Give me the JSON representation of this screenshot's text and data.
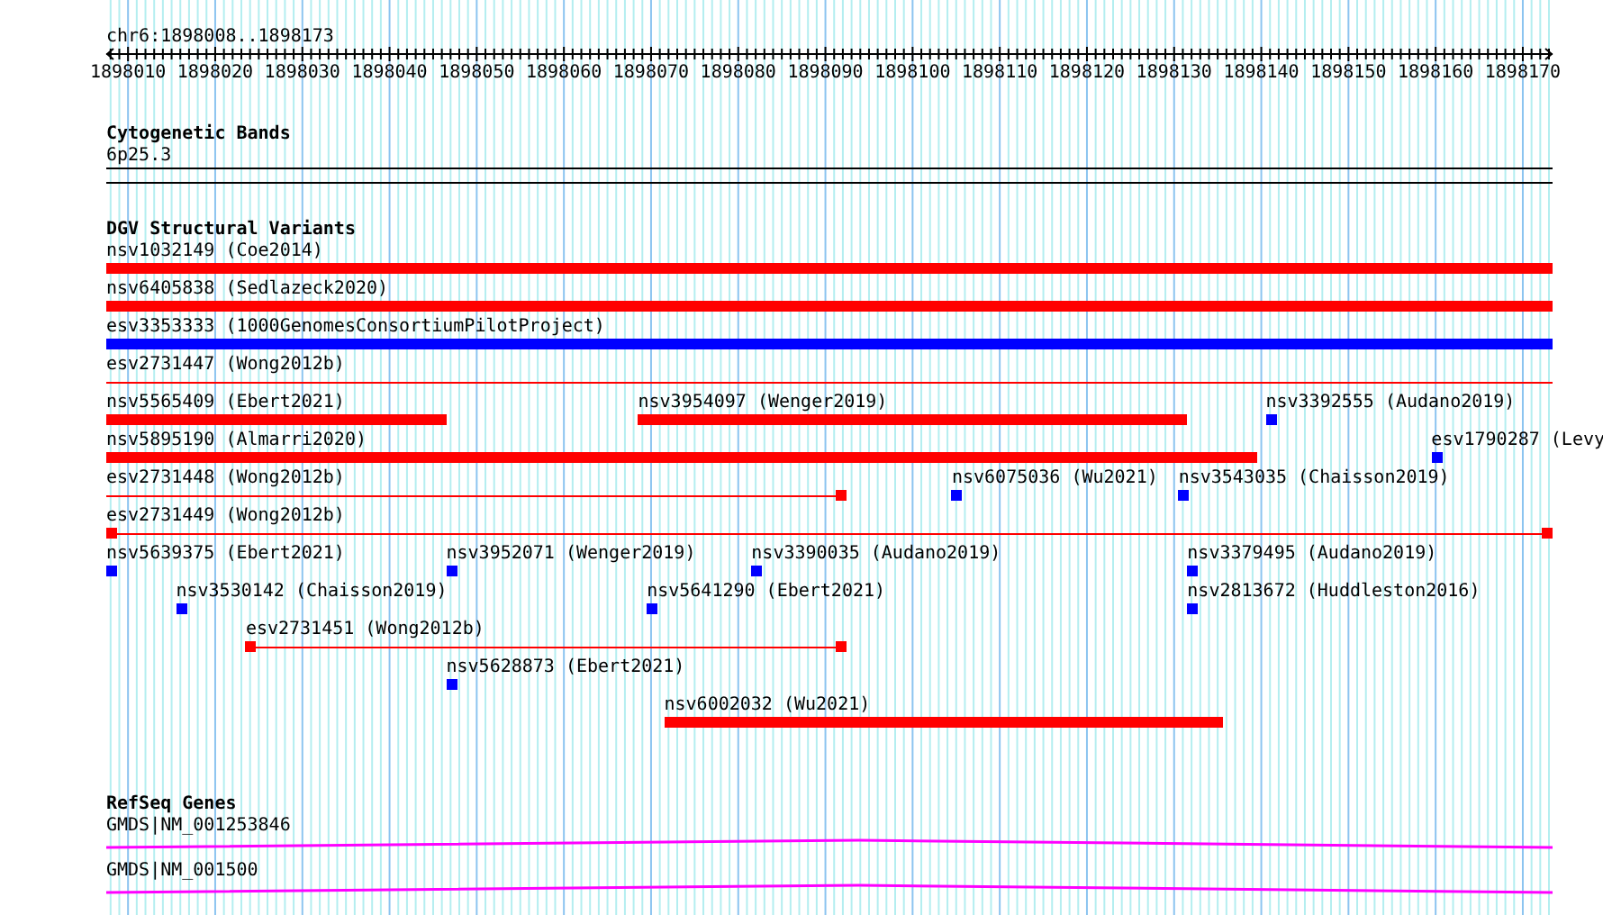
{
  "ruler": {
    "region": "chr6:1898008..1898173",
    "ticks": [
      "1898010",
      "1898020",
      "1898030",
      "1898040",
      "1898050",
      "1898060",
      "1898070",
      "1898080",
      "1898090",
      "1898100",
      "1898110",
      "1898120",
      "1898130",
      "1898140",
      "1898150",
      "1898160",
      "1898170"
    ]
  },
  "tracks": [
    {
      "kind": "band",
      "title": "Cytogenetic Bands",
      "label": "6p25.3"
    },
    {
      "kind": "variants",
      "title": "DGV Structural Variants",
      "lanes": [
        {
          "features": [
            {
              "label": "nsv1032149 (Coe2014)",
              "kind": "bar",
              "color": "#ff0000"
            }
          ]
        },
        {
          "features": [
            {
              "label": "nsv6405838 (Sedlazeck2020)",
              "kind": "bar",
              "color": "#ff0000"
            }
          ]
        },
        {
          "features": [
            {
              "label": "esv3353333 (1000GenomesConsortiumPilotProject)",
              "kind": "bar",
              "color": "#0000ff"
            }
          ]
        },
        {
          "features": [
            {
              "label": "esv2731447 (Wong2012b)",
              "kind": "thin",
              "color": "#ff0000"
            }
          ]
        },
        {
          "features": [
            {
              "label": "nsv5565409 (Ebert2021)",
              "kind": "bar",
              "color": "#ff0000"
            },
            {
              "label": "nsv3954097 (Wenger2019)",
              "kind": "bar",
              "color": "#ff0000"
            },
            {
              "label": "nsv3392555 (Audano2019)",
              "kind": "point",
              "color": "#0000ff"
            }
          ]
        },
        {
          "features": [
            {
              "label": "nsv5895190 (Almarri2020)",
              "kind": "bar",
              "color": "#ff0000"
            },
            {
              "label": "esv1790287 (Levy",
              "kind": "point",
              "color": "#0000ff"
            }
          ]
        },
        {
          "features": [
            {
              "label": "esv2731448 (Wong2012b)",
              "kind": "thin",
              "color": "#ff0000"
            },
            {
              "label": "nsv6075036 (Wu2021)",
              "kind": "point",
              "color": "#0000ff"
            },
            {
              "label": "nsv3543035 (Chaisson2019)",
              "kind": "point",
              "color": "#0000ff"
            }
          ]
        },
        {
          "features": [
            {
              "label": "esv2731449 (Wong2012b)",
              "kind": "thin",
              "color": "#ff0000"
            }
          ]
        },
        {
          "features": [
            {
              "label": "nsv5639375 (Ebert2021)",
              "kind": "point",
              "color": "#0000ff"
            },
            {
              "label": "nsv3952071 (Wenger2019)",
              "kind": "point",
              "color": "#0000ff"
            },
            {
              "label": "nsv3390035 (Audano2019)",
              "kind": "point",
              "color": "#0000ff"
            },
            {
              "label": "nsv3379495 (Audano2019)",
              "kind": "point",
              "color": "#0000ff"
            }
          ]
        },
        {
          "features": [
            {
              "label": "nsv3530142 (Chaisson2019)",
              "kind": "point",
              "color": "#0000ff"
            },
            {
              "label": "nsv5641290 (Ebert2021)",
              "kind": "point",
              "color": "#0000ff"
            },
            {
              "label": "nsv2813672 (Huddleston2016)",
              "kind": "point",
              "color": "#0000ff"
            }
          ]
        },
        {
          "features": [
            {
              "label": "esv2731451 (Wong2012b)",
              "kind": "thin",
              "color": "#ff0000"
            }
          ]
        },
        {
          "features": [
            {
              "label": "nsv5628873 (Ebert2021)",
              "kind": "point",
              "color": "#0000ff"
            }
          ]
        },
        {
          "features": [
            {
              "label": "nsv6002032 (Wu2021)",
              "kind": "bar",
              "color": "#ff0000"
            }
          ]
        }
      ]
    },
    {
      "kind": "genes",
      "title": "RefSeq Genes",
      "genes": [
        {
          "label": "GMDS|NM_001253846"
        },
        {
          "label": "GMDS|NM_001500"
        }
      ]
    }
  ]
}
